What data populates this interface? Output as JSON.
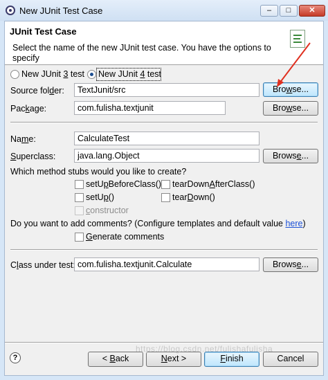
{
  "window": {
    "title": "New JUnit Test Case",
    "controls": {
      "minimize": "–",
      "maximize": "□",
      "close": "✕"
    }
  },
  "banner": {
    "title": "JUnit Test Case",
    "description": "Select the name of the new JUnit test case. You have the options to specify",
    "icon": "junit-wizard-icon"
  },
  "version": {
    "junit3": {
      "pre": "New JUnit ",
      "key": "3",
      "post": " test",
      "selected": false
    },
    "junit4": {
      "pre": "New JUnit ",
      "key": "4",
      "post": " test",
      "selected": true
    }
  },
  "source_folder": {
    "label_pre": "Source fol",
    "label_key": "d",
    "label_post": "er:",
    "value": "TextJunit/src",
    "browse": {
      "pre": "Bro",
      "key": "w",
      "post": "se..."
    }
  },
  "package": {
    "label_pre": "Pac",
    "label_key": "k",
    "label_post": "age:",
    "value": "com.fulisha.textjunit",
    "browse": {
      "pre": "Bro",
      "key": "w",
      "post": "se..."
    }
  },
  "name": {
    "label_pre": "Na",
    "label_key": "m",
    "label_post": "e:",
    "value": "CalculateTest"
  },
  "superclass": {
    "label_pre": "",
    "label_key": "S",
    "label_post": "uperclass:",
    "value": "java.lang.Object",
    "browse": {
      "pre": "Brows",
      "key": "e",
      "post": "..."
    }
  },
  "stubs": {
    "question": "Which method stubs would you like to create?",
    "setUpBeforeClass": {
      "pre": "setU",
      "key": "p",
      "post": "BeforeClass()",
      "checked": false
    },
    "tearDownAfterClass": {
      "pre": "tearDown",
      "key": "A",
      "post": "fterClass()",
      "checked": false
    },
    "setUp": {
      "pre": "setU",
      "key": "p",
      "post": "()",
      "checked": false
    },
    "tearDown": {
      "pre": "tear",
      "key": "D",
      "post": "own()",
      "checked": false
    },
    "constructor": {
      "pre": "",
      "key": "c",
      "post": "onstructor",
      "checked": false,
      "disabled": true
    }
  },
  "comments": {
    "question": "Do you want to add comments? (Configure templates and default value ",
    "link": "here",
    "question_end": ")",
    "generate": {
      "pre": "",
      "key": "G",
      "post": "enerate comments",
      "checked": false
    }
  },
  "class_under_test": {
    "label_pre": "C",
    "label_key": "l",
    "label_post": "ass under test:",
    "value": "com.fulisha.textjunit.Calculate",
    "browse": {
      "pre": "Brows",
      "key": "e",
      "post": "..."
    }
  },
  "footer": {
    "help": "?",
    "back": {
      "pre": "< ",
      "key": "B",
      "post": "ack"
    },
    "next": {
      "pre": "",
      "key": "N",
      "post": "ext >"
    },
    "finish": {
      "pre": "",
      "key": "F",
      "post": "inish"
    },
    "cancel": "Cancel"
  },
  "watermark": "https://blog.csdn.net/fulishafulisha"
}
